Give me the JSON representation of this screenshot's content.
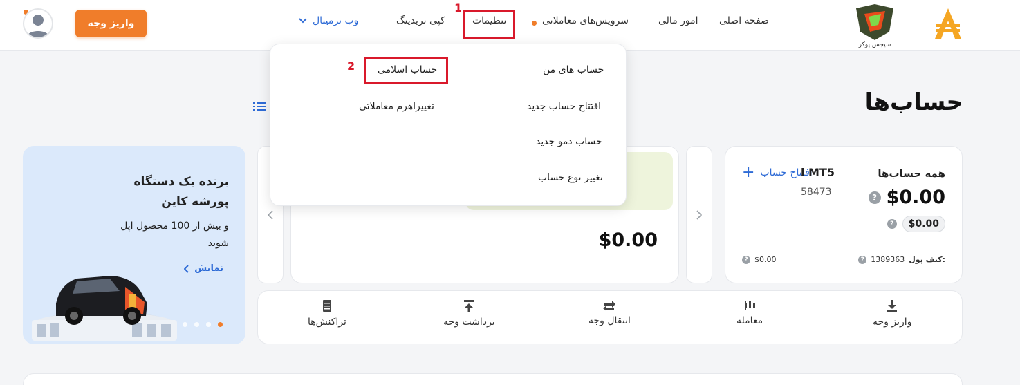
{
  "nav": {
    "home": "صفحه اصلی",
    "finance": "امور مالی",
    "services": "سرویس‌های معاملاتی",
    "settings": "تنظیمات",
    "copy_trading": "کپی تریدینگ",
    "web_terminal": "وب ترمینال",
    "deposit_button": "واریز وجه",
    "logo_caption": "سیجس پوکر"
  },
  "annotations": {
    "step1": "1",
    "step2": "2"
  },
  "page": {
    "title": "حساب‌ها"
  },
  "settings_menu": {
    "my_accounts": "حساب های من",
    "new_account": "افتتاح حساب جدید",
    "new_demo": "حساب دمو جدید",
    "change_type": "تغییر نوع حساب",
    "islamic": "حساب اسلامی",
    "leverage": "تغییراهرم معاملاتی"
  },
  "summary": {
    "title": "همه حساب‌ها",
    "open_account": "افتتاح حساب",
    "total": "$0.00",
    "sub_total": "$0.00",
    "wallet_label": "کیف پول:",
    "wallet_id": "1389363",
    "wallet_balance": "$0.00"
  },
  "account_card": {
    "name": "l MT5",
    "number": "58473",
    "balance": "$0.00"
  },
  "promo": {
    "title_line1": "برنده یک دستگاه",
    "title_line2": "پورشه کاین",
    "body_line1": "و بیش از 100 محصول اپل",
    "body_line2": "شوید",
    "link": "نمایش"
  },
  "actions": {
    "deposit": "واریز وجه",
    "trade": "معامله",
    "transfer": "انتقال وجه",
    "withdraw": "برداشت وجه",
    "transactions": "تراکنش‌ها"
  },
  "colors": {
    "accent": "#f07d2a",
    "annotation_red": "#d9192b",
    "link_blue": "#2e6bd6",
    "account_card_tint": "#eef4dc"
  }
}
